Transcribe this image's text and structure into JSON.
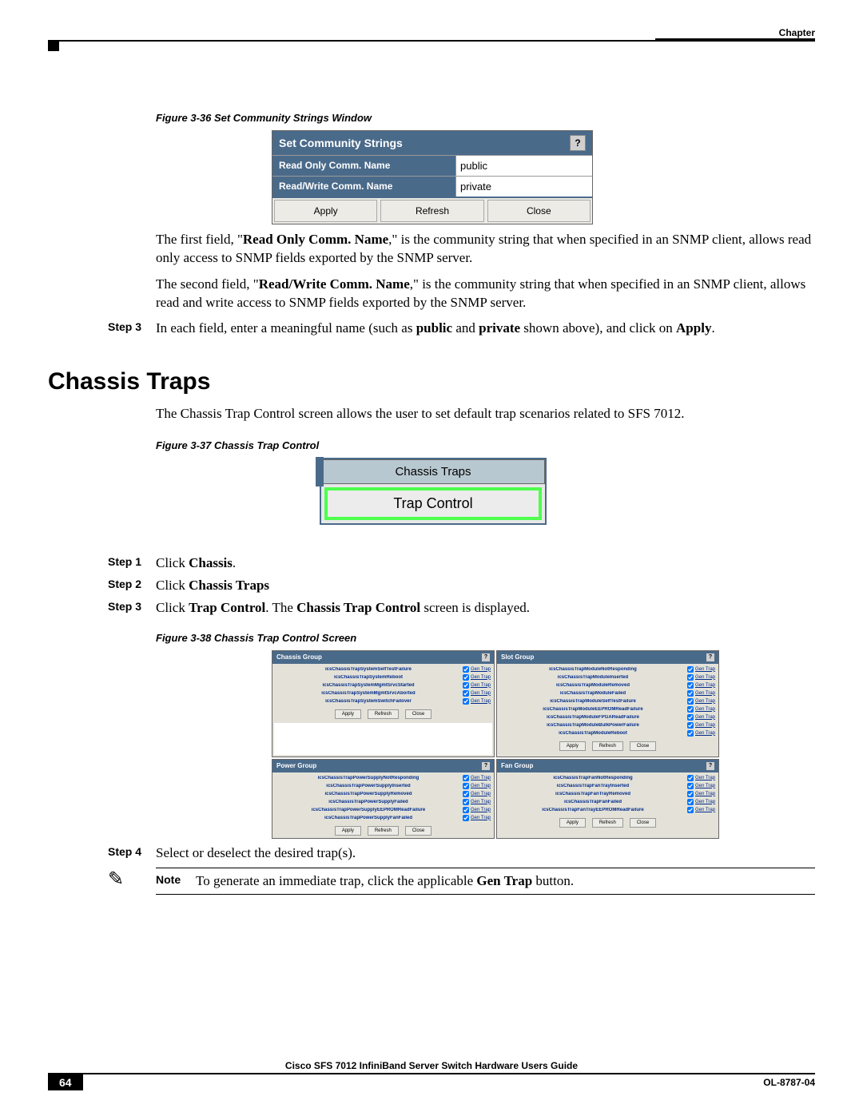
{
  "header": {
    "chapter": "Chapter"
  },
  "fig36": {
    "caption": "Figure 3-36   Set Community Strings Window",
    "title": "Set Community Strings",
    "help": "?",
    "row1_label": "Read Only Comm. Name",
    "row1_value": "public",
    "row2_label": "Read/Write Comm. Name",
    "row2_value": "private",
    "btn_apply": "Apply",
    "btn_refresh": "Refresh",
    "btn_close": "Close"
  },
  "para1_a": "The first field, \"",
  "para1_b": "Read Only Comm. Name",
  "para1_c": ",\" is the community string that when specified in an SNMP client, allows read only access to SNMP fields exported by the SNMP server.",
  "para2_a": "The second field, \"",
  "para2_b": "Read/Write Comm. Name",
  "para2_c": ",\" is the community string that when specified in an SNMP client, allows read and write access to SNMP fields exported by the SNMP server.",
  "step3top_label": "Step 3",
  "step3top_a": "In each field, enter a meaningful name (such as ",
  "step3top_b": "public",
  "step3top_c": " and ",
  "step3top_d": "private",
  "step3top_e": " shown above), and click on ",
  "step3top_f": "Apply",
  "step3top_g": ".",
  "h2": "Chassis Traps",
  "intro": "The Chassis Trap Control screen allows the user to set default trap scenarios related to SFS 7012.",
  "fig37": {
    "caption": "Figure 3-37   Chassis Trap Control",
    "header": "Chassis Traps",
    "button": "Trap Control"
  },
  "step1_label": "Step 1",
  "step1_a": "Click ",
  "step1_b": "Chassis",
  "step1_c": ".",
  "step2_label": "Step 2",
  "step2_a": "Click ",
  "step2_b": "Chassis Traps",
  "step3_label": "Step 3",
  "step3_a": "Click ",
  "step3_b": "Trap Control",
  "step3_c": ". The ",
  "step3_d": "Chassis Trap Control",
  "step3_e": " screen is displayed.",
  "fig38": {
    "caption": "Figure 3-38   Chassis Trap Control Screen",
    "gen_trap": "Gen Trap",
    "btn_apply": "Apply",
    "btn_refresh": "Refresh",
    "btn_close": "Close",
    "chassis": {
      "title": "Chassis Group",
      "rows": [
        "icsChassisTrapSystemSelfTestFailure",
        "icsChassisTrapSystemReboot",
        "icsChassisTrapSystemMgmtSrvcStarted",
        "icsChassisTrapSystemMgmtSrvcAborted",
        "icsChassisTrapSystemSwitchFailover"
      ]
    },
    "slot": {
      "title": "Slot Group",
      "rows": [
        "icsChassisTrapModuleNotResponding",
        "icsChassisTrapModuleInserted",
        "icsChassisTrapModuleRemoved",
        "icsChassisTrapModuleFailed",
        "icsChassisTrapModuleSelfTestFailure",
        "icsChassisTrapModuleEEPROMReadFailure",
        "icsChassisTrapModuleFPGAReadFailure",
        "icsChassisTrapModuleBulkPowerFailure",
        "icsChassisTrapModuleReboot"
      ]
    },
    "power": {
      "title": "Power Group",
      "rows": [
        "icsChassisTrapPowerSupplyNotResponding",
        "icsChassisTrapPowerSupplyInserted",
        "icsChassisTrapPowerSupplyRemoved",
        "icsChassisTrapPowerSupplyFailed",
        "icsChassisTrapPowerSupplyEEPROMReadFailure",
        "icsChassisTrapPowerSupplyFanFailed"
      ]
    },
    "fan": {
      "title": "Fan Group",
      "rows": [
        "icsChassisTrapFanNotResponding",
        "icsChassisTrapFanTrayInserted",
        "icsChassisTrapFanTrayRemoved",
        "icsChassisTrapFanFailed",
        "icsChassisTrapFanTrayEEPROMReadFailure"
      ]
    }
  },
  "step4_label": "Step 4",
  "step4_text": "Select or deselect the desired trap(s).",
  "note_label": "Note",
  "note_a": "To generate an immediate trap, click the applicable ",
  "note_b": "Gen Trap",
  "note_c": " button.",
  "footer": {
    "title": "Cisco SFS 7012 InfiniBand Server Switch Hardware Users Guide",
    "page": "64",
    "ref": "OL-8787-04"
  }
}
